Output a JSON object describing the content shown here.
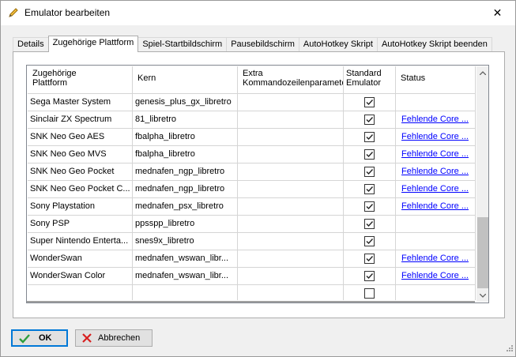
{
  "window": {
    "title": "Emulator bearbeiten",
    "close_glyph": "✕"
  },
  "tabs": [
    {
      "label": "Details"
    },
    {
      "label": "Zugehörige Plattform",
      "active": true
    },
    {
      "label": "Spiel-Startbildschirm"
    },
    {
      "label": "Pausebildschirm"
    },
    {
      "label": "AutoHotkey Skript"
    },
    {
      "label": "AutoHotkey Skript beenden"
    }
  ],
  "grid": {
    "columns": {
      "platform_line1": "Zugehörige",
      "platform_line2": "Plattform",
      "core": "Kern",
      "extra_line1": "Extra",
      "extra_line2": "Kommandozeilenparamete",
      "default_line1": "Standard",
      "default_line2": "Emulator",
      "status": "Status"
    },
    "rows": [
      {
        "platform": "Sega Master System",
        "core": "genesis_plus_gx_libretro",
        "extra": "",
        "default": true,
        "status": ""
      },
      {
        "platform": "Sinclair ZX Spectrum",
        "core": "81_libretro",
        "extra": "",
        "default": true,
        "status": "Fehlende Core ..."
      },
      {
        "platform": "SNK Neo Geo AES",
        "core": "fbalpha_libretro",
        "extra": "",
        "default": true,
        "status": "Fehlende Core ..."
      },
      {
        "platform": "SNK Neo Geo MVS",
        "core": "fbalpha_libretro",
        "extra": "",
        "default": true,
        "status": "Fehlende Core ..."
      },
      {
        "platform": "SNK Neo Geo Pocket",
        "core": "mednafen_ngp_libretro",
        "extra": "",
        "default": true,
        "status": "Fehlende Core ..."
      },
      {
        "platform": "SNK Neo Geo Pocket C...",
        "core": "mednafen_ngp_libretro",
        "extra": "",
        "default": true,
        "status": "Fehlende Core ..."
      },
      {
        "platform": "Sony Playstation",
        "core": "mednafen_psx_libretro",
        "extra": "",
        "default": true,
        "status": "Fehlende Core ..."
      },
      {
        "platform": "Sony PSP",
        "core": "ppsspp_libretro",
        "extra": "",
        "default": true,
        "status": ""
      },
      {
        "platform": "Super Nintendo Enterta...",
        "core": "snes9x_libretro",
        "extra": "",
        "default": true,
        "status": ""
      },
      {
        "platform": "WonderSwan",
        "core": "mednafen_wswan_libr...",
        "extra": "",
        "default": true,
        "status": "Fehlende Core ..."
      },
      {
        "platform": "WonderSwan Color",
        "core": "mednafen_wswan_libr...",
        "extra": "",
        "default": true,
        "status": "Fehlende Core ..."
      },
      {
        "platform": "",
        "core": "",
        "extra": "",
        "default": false,
        "status": ""
      }
    ]
  },
  "buttons": {
    "ok_label": "OK",
    "cancel_label": "Abbrechen"
  },
  "colors": {
    "link": "#0000ff",
    "ok_border": "#0078d7",
    "ok_icon": "#2e9e3e",
    "cancel_icon": "#d82020"
  }
}
